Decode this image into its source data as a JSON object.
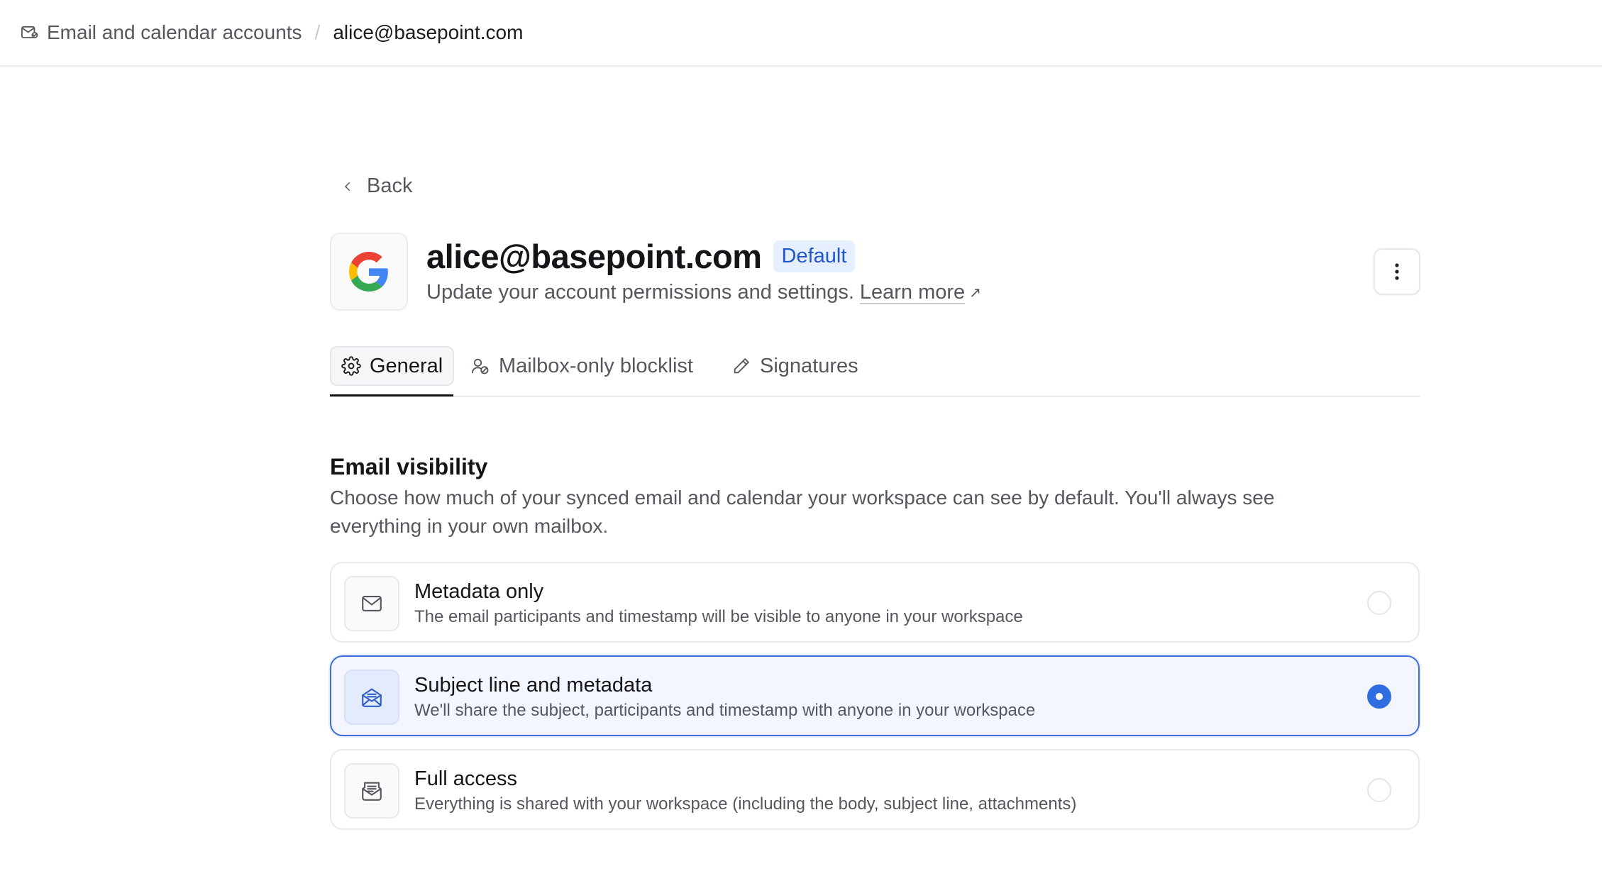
{
  "breadcrumb": {
    "root": "Email and calendar accounts",
    "separator": "/",
    "current": "alice@basepoint.com"
  },
  "back_label": "Back",
  "account": {
    "email": "alice@basepoint.com",
    "badge": "Default",
    "subtitle": "Update your account permissions and settings.",
    "learn_more": "Learn more",
    "learn_more_icon": "↗",
    "provider_icon": "google-logo"
  },
  "more_menu_icon": "⋮",
  "tabs": [
    {
      "label": "General",
      "icon": "gear-icon",
      "active": true
    },
    {
      "label": "Mailbox-only blocklist",
      "icon": "user-block-icon",
      "active": false
    },
    {
      "label": "Signatures",
      "icon": "pen-icon",
      "active": false
    }
  ],
  "email_visibility": {
    "title": "Email visibility",
    "description": "Choose how much of your synced email and calendar your workspace can see by default. You'll always see everything in your own mailbox.",
    "options": [
      {
        "title": "Metadata only",
        "description": "The email participants and timestamp will be visible to anyone in your workspace",
        "selected": false,
        "icon": "envelope-icon"
      },
      {
        "title": "Subject line and metadata",
        "description": "We'll share the subject, participants and timestamp with anyone in your workspace",
        "selected": true,
        "icon": "open-envelope-icon"
      },
      {
        "title": "Full access",
        "description": "Everything is shared with your workspace (including the body, subject line, attachments)",
        "selected": false,
        "icon": "envelope-letter-icon"
      }
    ]
  },
  "colors": {
    "accent": "#2f6de0",
    "badge_bg": "#e6efff",
    "badge_text": "#2156c9"
  }
}
